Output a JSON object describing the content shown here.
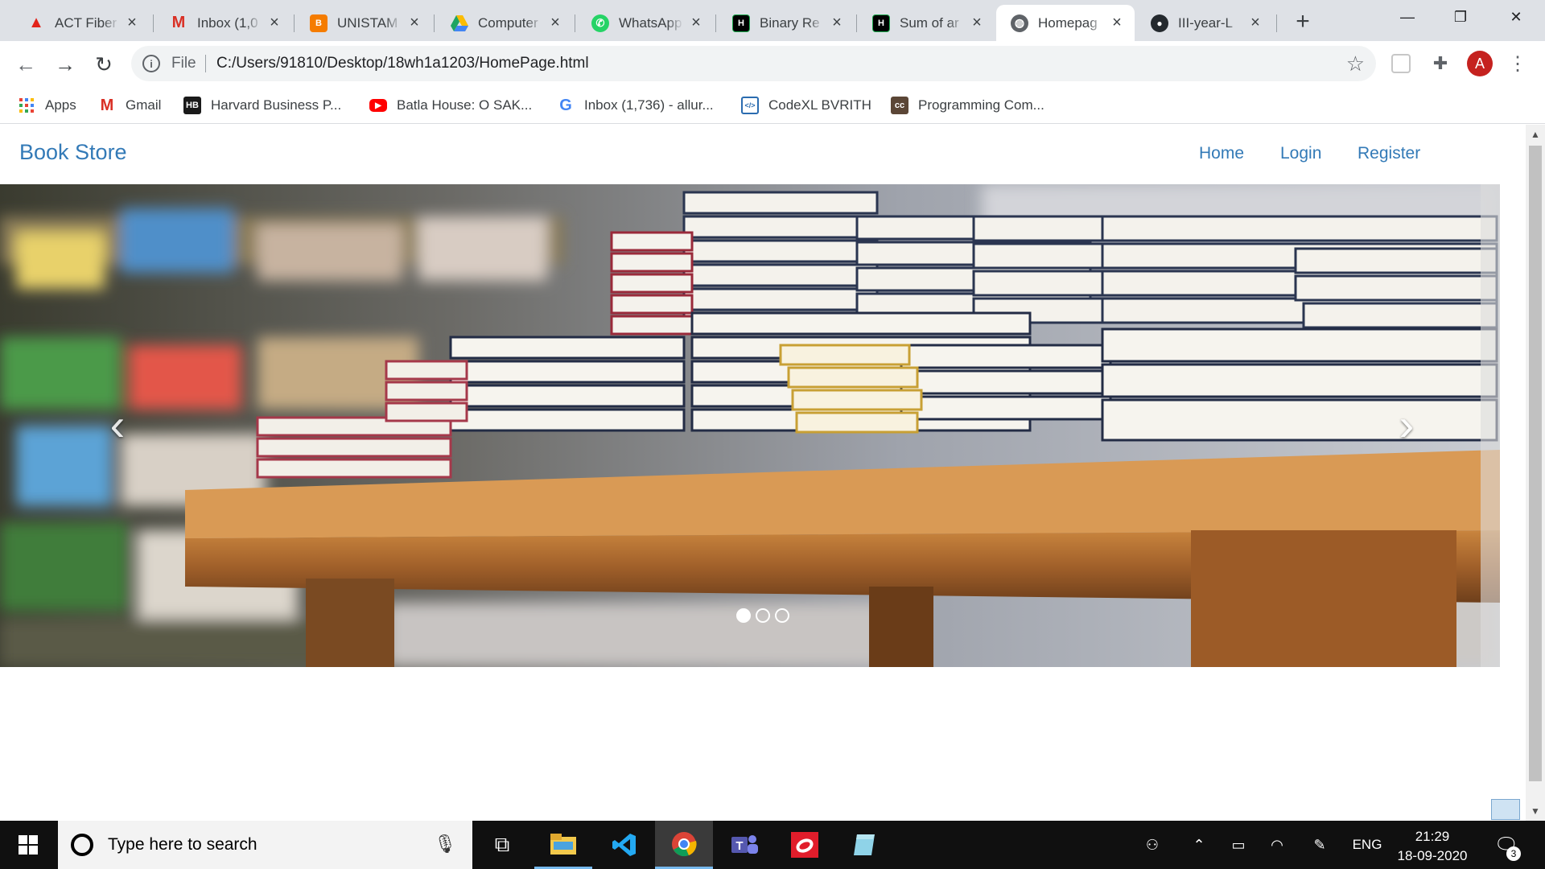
{
  "browser": {
    "tabs": [
      {
        "title": "ACT Fiber",
        "icon": "act-fibernet-icon",
        "color": "#e2231a",
        "active": false
      },
      {
        "title": "Inbox (1,0",
        "icon": "gmail-icon",
        "color": "#d93025",
        "active": false
      },
      {
        "title": "UNISTAM",
        "icon": "blogger-icon",
        "color": "#f57c00",
        "active": false
      },
      {
        "title": "Computer",
        "icon": "google-drive-icon",
        "color": "#1fa463",
        "active": false
      },
      {
        "title": "WhatsApp",
        "icon": "whatsapp-icon",
        "color": "#25d366",
        "active": false
      },
      {
        "title": "Binary Re",
        "icon": "hackerrank-icon",
        "color": "#000000",
        "active": false
      },
      {
        "title": "Sum of ar",
        "icon": "hackerrank-icon",
        "color": "#000000",
        "active": false
      },
      {
        "title": "Homepag",
        "icon": "globe-icon",
        "color": "#5f6368",
        "active": true
      },
      {
        "title": "III-year-L",
        "icon": "github-icon",
        "color": "#24292e",
        "active": false
      }
    ],
    "new_tab_label": "+",
    "window_controls": {
      "minimize": "—",
      "restore": "❐",
      "close": "✕"
    },
    "toolbar": {
      "back": "←",
      "forward": "→",
      "reload": "↻",
      "scheme": "File",
      "url": "C:/Users/91810/Desktop/18wh1a1203/HomePage.html",
      "avatar_letter": "A"
    },
    "bookmarks": [
      {
        "label": "Apps",
        "icon": "apps-grid-icon"
      },
      {
        "label": "Gmail",
        "icon": "gmail-icon"
      },
      {
        "label": "Harvard Business P...",
        "icon": "harvard-business-icon"
      },
      {
        "label": "Batla House: O SAK...",
        "icon": "youtube-icon"
      },
      {
        "label": "Inbox (1,736) - allur...",
        "icon": "google-icon"
      },
      {
        "label": "CodeXL BVRITH",
        "icon": "codexl-icon"
      },
      {
        "label": "Programming Com...",
        "icon": "codechef-icon"
      }
    ]
  },
  "site": {
    "brand": "Book Store",
    "nav": [
      "Home",
      "Login",
      "Register"
    ],
    "carousel": {
      "image_alt": "books stacked on wooden table in a book store",
      "prev_label": "‹",
      "next_label": "›",
      "slides": 3,
      "active_slide": 0
    }
  },
  "taskbar": {
    "search_placeholder": "Type here to search",
    "apps": [
      "task-view-icon",
      "file-explorer-icon",
      "vscode-icon",
      "chrome-icon",
      "teams-icon",
      "red-app-icon",
      "notepad-icon"
    ],
    "tray": {
      "language": "ENG",
      "time": "21:29",
      "date": "18-09-2020",
      "notifications": "3"
    }
  }
}
